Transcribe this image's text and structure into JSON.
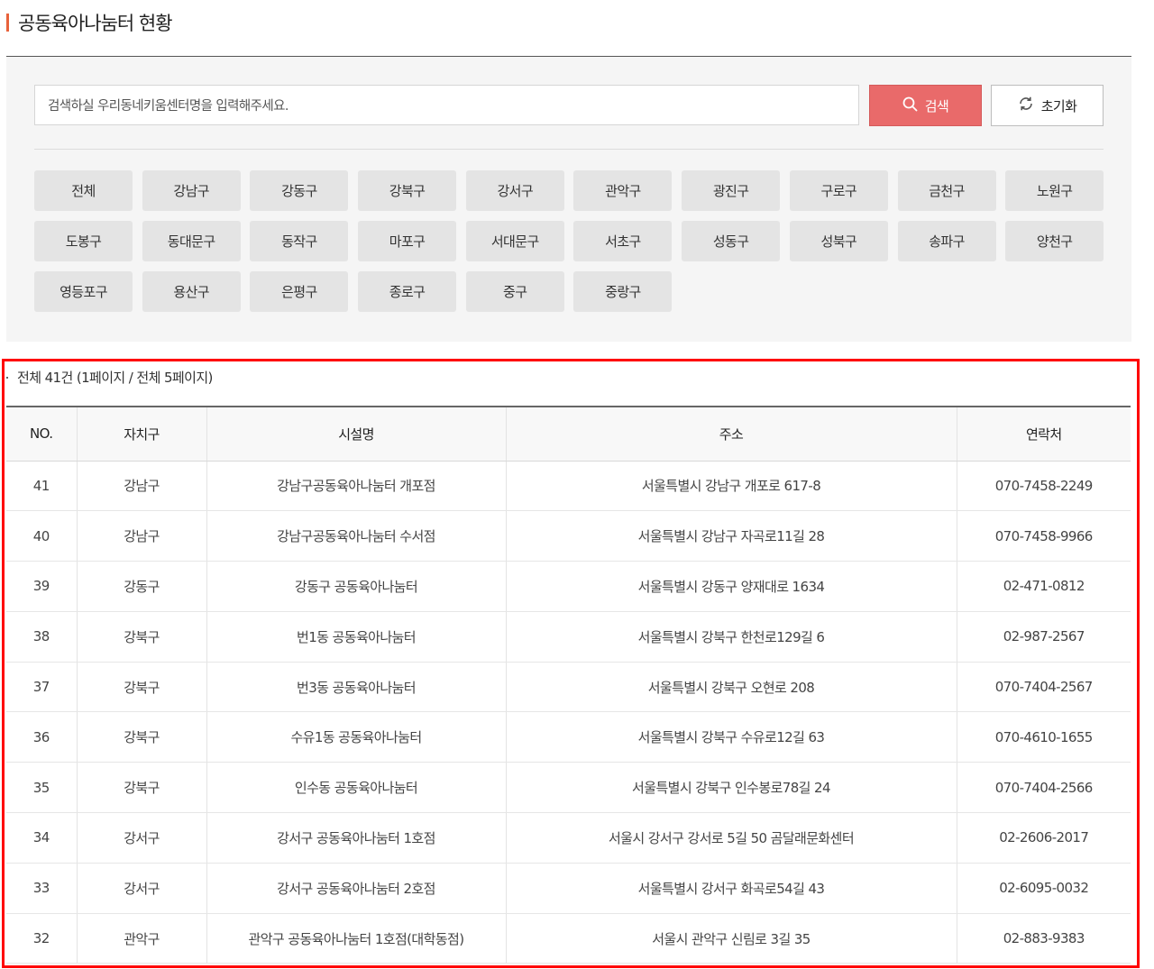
{
  "page": {
    "title": "공동육아나눔터 현황"
  },
  "search": {
    "placeholder": "검색하실 우리동네키움센터명을 입력해주세요.",
    "search_label": "검색",
    "reset_label": "초기화"
  },
  "districts": [
    "전체",
    "강남구",
    "강동구",
    "강북구",
    "강서구",
    "관악구",
    "광진구",
    "구로구",
    "금천구",
    "노원구",
    "도봉구",
    "동대문구",
    "동작구",
    "마포구",
    "서대문구",
    "서초구",
    "성동구",
    "성북구",
    "송파구",
    "양천구",
    "영등포구",
    "용산구",
    "은평구",
    "종로구",
    "중구",
    "중랑구"
  ],
  "results": {
    "summary": "전체 41건 (1페이지 / 전체 5페이지)"
  },
  "table": {
    "headers": [
      "NO.",
      "자치구",
      "시설명",
      "주소",
      "연락처"
    ],
    "rows": [
      [
        "41",
        "강남구",
        "강남구공동육아나눔터 개포점",
        "서울특별시 강남구 개포로 617-8",
        "070-7458-2249"
      ],
      [
        "40",
        "강남구",
        "강남구공동육아나눔터 수서점",
        "서울특별시 강남구 자곡로11길 28",
        "070-7458-9966"
      ],
      [
        "39",
        "강동구",
        "강동구 공동육아나눔터",
        "서울특별시 강동구 양재대로 1634",
        "02-471-0812"
      ],
      [
        "38",
        "강북구",
        "번1동 공동육아나눔터",
        "서울특별시 강북구 한천로129길 6",
        "02-987-2567"
      ],
      [
        "37",
        "강북구",
        "번3동 공동육아나눔터",
        "서울특별시 강북구 오현로 208",
        "070-7404-2567"
      ],
      [
        "36",
        "강북구",
        "수유1동 공동육아나눔터",
        "서울특별시 강북구 수유로12길 63",
        "070-4610-1655"
      ],
      [
        "35",
        "강북구",
        "인수동 공동육아나눔터",
        "서울특별시 강북구 인수봉로78길 24",
        "070-7404-2566"
      ],
      [
        "34",
        "강서구",
        "강서구 공동육아나눔터 1호점",
        "서울시 강서구 강서로 5길 50 곰달래문화센터",
        "02-2606-2017"
      ],
      [
        "33",
        "강서구",
        "강서구 공동육아나눔터 2호점",
        "서울특별시 강서구 화곡로54길 43",
        "02-6095-0032"
      ],
      [
        "32",
        "관악구",
        "관악구 공동육아나눔터 1호점(대학동점)",
        "서울시 관악구 신림로 3길 35",
        "02-883-9383"
      ]
    ]
  },
  "colors": {
    "accent": "#e8623b",
    "search_button": "#e96a6a",
    "highlight": "#ff0000"
  }
}
